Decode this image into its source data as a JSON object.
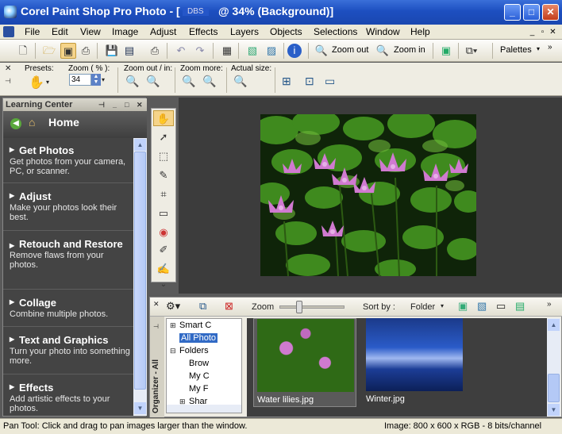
{
  "window": {
    "title": "Corel Paint Shop Pro Photo - [",
    "title_file": "DBS",
    "title_zoom": "@  34% (Background)]",
    "min": "_",
    "max": "□",
    "close": "✕"
  },
  "menu": [
    "File",
    "Edit",
    "View",
    "Image",
    "Adjust",
    "Effects",
    "Layers",
    "Objects",
    "Selections",
    "Window",
    "Help"
  ],
  "toolbar": {
    "zoom_out": "Zoom out",
    "zoom_in": "Zoom in",
    "palettes": "Palettes"
  },
  "tool_options": {
    "presets": "Presets:",
    "zoom_pct": "Zoom ( % ):",
    "zoom_value": "34",
    "zoom_out_in": "Zoom out / in:",
    "zoom_more": "Zoom more:",
    "actual_size": "Actual size:"
  },
  "learning_center": {
    "title": "Learning Center",
    "home": "Home",
    "items": [
      {
        "heading": "Get Photos",
        "desc": "Get photos from your camera, PC, or scanner."
      },
      {
        "heading": "Adjust",
        "desc": "Make your photos look their best."
      },
      {
        "heading": "Retouch and Restore",
        "desc": "Remove flaws from your photos."
      },
      {
        "heading": "Collage",
        "desc": "Combine multiple photos."
      },
      {
        "heading": "Text and Graphics",
        "desc": "Turn your photo into something more."
      },
      {
        "heading": "Effects",
        "desc": "Add artistic effects to your photos."
      }
    ]
  },
  "organizer": {
    "zoom": "Zoom",
    "zoom_level": 0.3,
    "sort_by": "Sort by :",
    "sort_value": "Folder",
    "side_label": "Organizer - All",
    "tree": [
      "Smart C",
      "All Photo",
      "Folders",
      "Brow",
      "My C",
      "My F",
      "Shar"
    ],
    "thumbnails": [
      "Water lilies.jpg",
      "Winter.jpg"
    ]
  },
  "status": {
    "left": "Pan Tool: Click and drag to pan images larger than the window.",
    "right": "Image:  800 x 600 x RGB - 8 bits/channel"
  },
  "colors": {
    "titlebar": "#1d4fc0",
    "panel_dark": "#444444",
    "canvas_bg": "#3c3c3c",
    "selection": "#316ac5"
  }
}
